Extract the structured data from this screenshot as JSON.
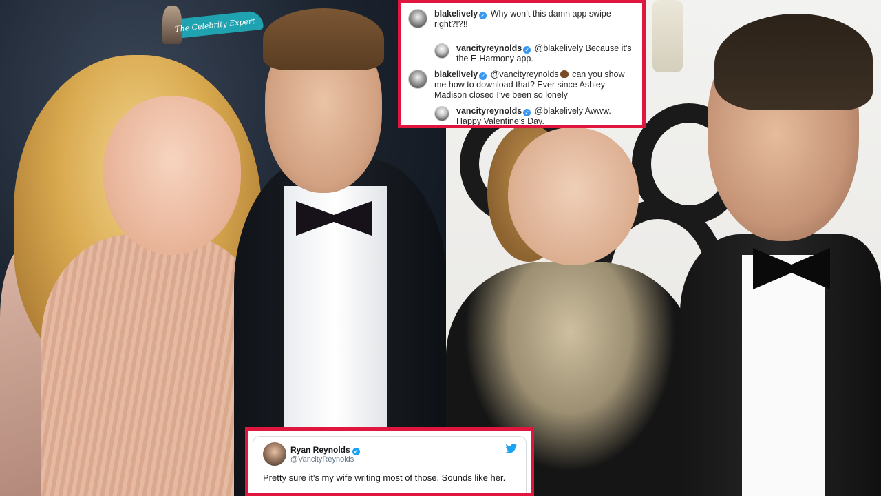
{
  "watermark": {
    "text": "The Celebrity Expert"
  },
  "instagram": {
    "comments": [
      {
        "user": "blakelively",
        "verified": true,
        "text": "Why won’t this damn app swipe right?!?!!",
        "reply": false
      },
      {
        "user": "vancityreynolds",
        "verified": true,
        "text": "@blakelively Because it’s the E-Harmony app.",
        "reply": true
      },
      {
        "user": "blakelively",
        "verified": true,
        "mention": "@vancityreynolds",
        "emoji": "poop-emoji",
        "text": "can you show me how to download that? Ever since Ashley Madison closed I’ve been so lonely",
        "reply": false
      },
      {
        "user": "vancityreynolds",
        "verified": true,
        "text": "@blakelively Awww. Happy Valentine’s Day.",
        "reply": true
      }
    ]
  },
  "tweet": {
    "name": "Ryan Reynolds",
    "handle": "@VancityReynolds",
    "verified": true,
    "icon": "twitter-bird-icon",
    "body": "Pretty sure it's my wife writing most of those. Sounds like her."
  },
  "colors": {
    "highlight_border": "#e0163e",
    "instagram_verified": "#3897f0",
    "twitter_blue": "#1da1f2"
  }
}
